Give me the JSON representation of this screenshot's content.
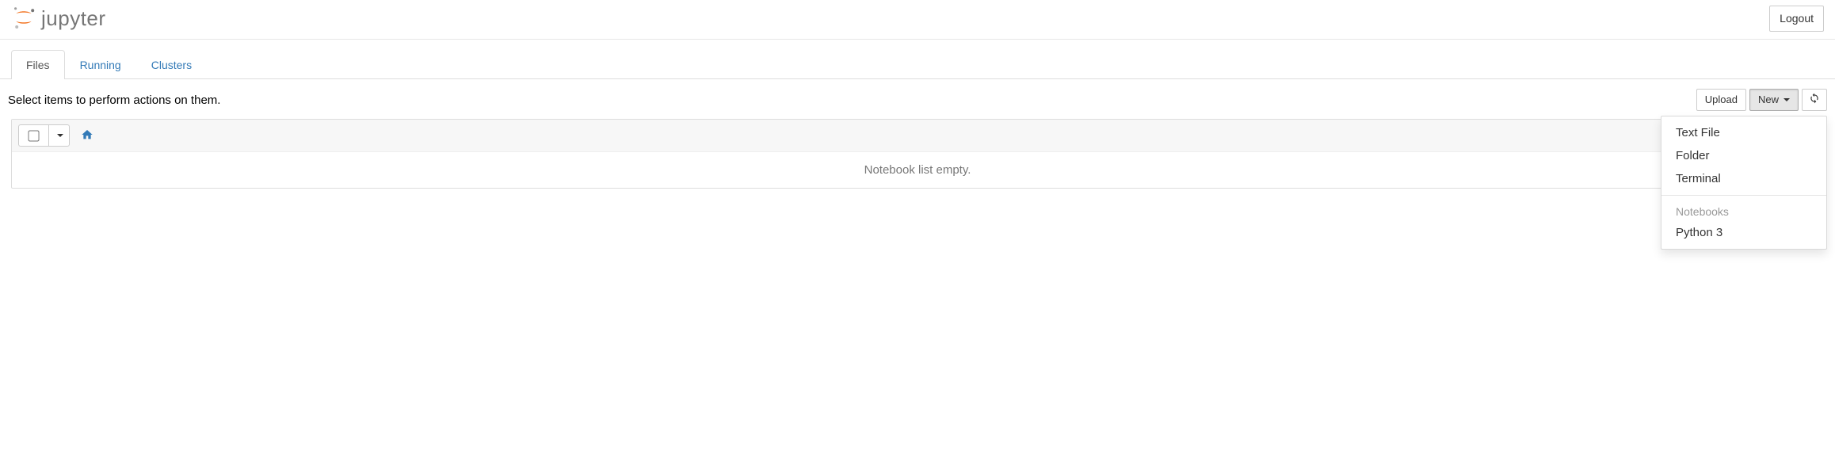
{
  "header": {
    "logo_text": "jupyter",
    "logout_label": "Logout"
  },
  "tabs": [
    {
      "label": "Files",
      "active": true
    },
    {
      "label": "Running",
      "active": false
    },
    {
      "label": "Clusters",
      "active": false
    }
  ],
  "actions": {
    "instruction": "Select items to perform actions on them.",
    "upload_label": "Upload",
    "new_label": "New"
  },
  "new_menu": {
    "items": [
      "Text File",
      "Folder",
      "Terminal"
    ],
    "section_header": "Notebooks",
    "kernels": [
      "Python 3"
    ]
  },
  "list": {
    "empty_message": "Notebook list empty."
  }
}
